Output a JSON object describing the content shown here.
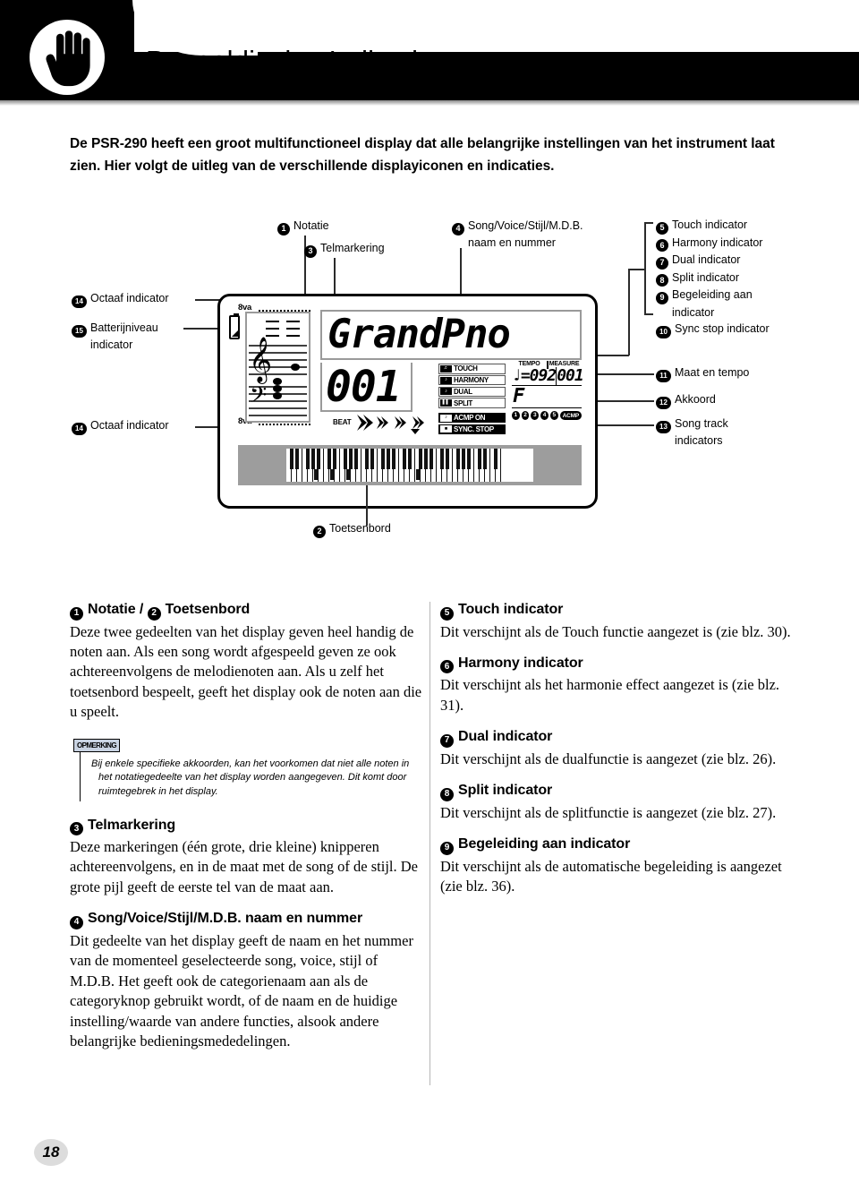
{
  "header": {
    "title": "Paneeldisplay Indicaties",
    "icon": "hand-icon"
  },
  "intro": "De PSR-290 heeft een groot multifunctioneel display dat alle belangrijke instellingen van het instrument laat zien. Hier volgt de uitleg van de verschillende displayiconen en indicaties.",
  "diagram": {
    "callouts": {
      "notatie": {
        "num": "1",
        "label": "Notatie"
      },
      "telmarkering": {
        "num": "3",
        "label": "Telmarkering"
      },
      "songvoice_l1": {
        "num": "4",
        "label": "Song/Voice/Stijl/M.D.B."
      },
      "songvoice_l2": {
        "label": "naam en nummer"
      },
      "octaaf_top": {
        "num": "14",
        "label": "Octaaf indicator"
      },
      "batterij_l1": {
        "num": "15",
        "label": "Batterijniveau"
      },
      "batterij_l2": {
        "label": "indicator"
      },
      "octaaf_bottom": {
        "num": "14",
        "label": "Octaaf indicator"
      },
      "toetsenbord": {
        "num": "2",
        "label": "Toetsenbord"
      },
      "maat_tempo": {
        "num": "11",
        "label": "Maat en tempo"
      },
      "akkoord": {
        "num": "12",
        "label": "Akkoord"
      },
      "songtrack_l1": {
        "num": "13",
        "label": "Song track"
      },
      "songtrack_l2": {
        "label": "indicators"
      }
    },
    "right_list": [
      {
        "num": "5",
        "label": "Touch indicator"
      },
      {
        "num": "6",
        "label": "Harmony indicator"
      },
      {
        "num": "7",
        "label": "Dual indicator"
      },
      {
        "num": "8",
        "label": "Split indicator"
      },
      {
        "num": "9",
        "label": "Begeleiding aan"
      },
      {
        "num": "",
        "label": "indicator"
      },
      {
        "num": "10",
        "label": "Sync stop indicator"
      }
    ],
    "lcd": {
      "octave_top": "8va",
      "octave_bottom": "8va",
      "voice_name": "GrandPno",
      "voice_number": "001",
      "beat_label": "BEAT",
      "tempo_header": "TEMPO",
      "measure_header": "MEASURE",
      "tempo_value": "♩=092",
      "measure_value": "001",
      "chord": "F",
      "indicators": [
        {
          "icon": "touch-icon",
          "label": "TOUCH",
          "active": false
        },
        {
          "icon": "harmony-icon",
          "label": "HARMONY",
          "active": false
        },
        {
          "icon": "dual-icon",
          "label": "DUAL",
          "active": false
        },
        {
          "icon": "split-icon",
          "label": "SPLIT",
          "active": false
        },
        {
          "icon": "acmp-icon",
          "label": "ACMP ON",
          "active": true
        },
        {
          "icon": "syncstop-icon",
          "label": "SYNC. STOP",
          "active": true
        }
      ],
      "tracks": [
        "1",
        "2",
        "3",
        "4",
        "5"
      ],
      "acmp_badge": "ACMP"
    }
  },
  "sections_left": [
    {
      "num": "1",
      "heading": "Notatie / ❷ Toetsenbord",
      "heading_raw": "Notatie /",
      "heading_num2": "2",
      "heading_tail": "Toetsenbord",
      "body": "Deze twee gedeelten van het display geven heel handig de noten aan. Als een song wordt afgespeeld geven ze ook achtereenvolgens de melodienoten aan. Als u zelf het toetsenbord bespeelt, geeft het display ook de noten aan die u speelt."
    },
    {
      "num": "3",
      "heading": "Telmarkering",
      "body": "Deze markeringen (één grote, drie kleine) knipperen achtereenvolgens, en in de maat met de song of de stijl. De grote pijl geeft de eerste tel van de maat aan."
    },
    {
      "num": "4",
      "heading": "Song/Voice/Stijl/M.D.B. naam en nummer",
      "body": "Dit gedeelte van het display geeft de naam en het nummer van de momenteel geselecteerde song, voice, stijl of M.D.B. Het geeft ook de categorienaam aan als de categoryknop gebruikt wordt, of de naam en de huidige instelling/waarde van andere functies, alsook andere belangrijke bedieningsmededelingen."
    }
  ],
  "note": {
    "tag": "OPMERKING",
    "text": "Bij enkele specifieke akkoorden, kan het voorkomen dat niet alle noten in het notatiegedeelte van het display worden aangegeven. Dit komt door ruimtegebrek in het display."
  },
  "sections_right": [
    {
      "num": "5",
      "heading": "Touch indicator",
      "body": "Dit verschijnt als de Touch functie aangezet is (zie blz. 30)."
    },
    {
      "num": "6",
      "heading": "Harmony indicator",
      "body": "Dit verschijnt als het harmonie effect aangezet is (zie blz. 31)."
    },
    {
      "num": "7",
      "heading": "Dual indicator",
      "body": "Dit verschijnt als de dualfunctie is aangezet (zie blz. 26)."
    },
    {
      "num": "8",
      "heading": "Split indicator",
      "body": "Dit verschijnt als de splitfunctie is aangezet (zie blz. 27)."
    },
    {
      "num": "9",
      "heading": "Begeleiding aan indicator",
      "body": "Dit verschijnt als de automatische begeleiding is aangezet (zie blz. 36)."
    }
  ],
  "footer": {
    "page": "18"
  }
}
